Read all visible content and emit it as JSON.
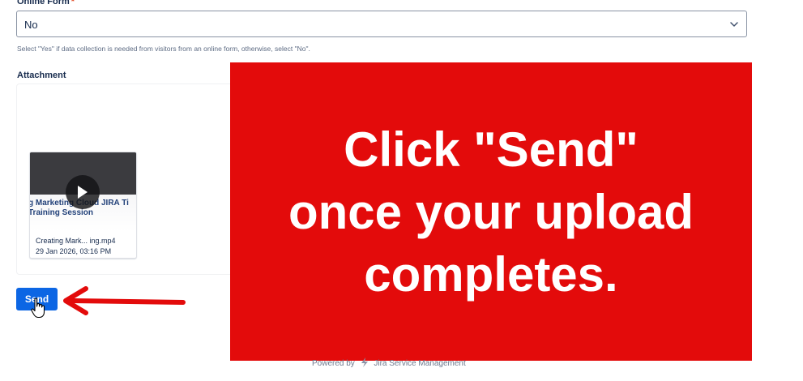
{
  "form": {
    "online_form": {
      "label": "Online Form",
      "required_marker": "*",
      "value": "No",
      "helper_text": "Select \"Yes\" if data collection is needed from visitors from an online form, otherwise, select \"No\"."
    },
    "attachment": {
      "label": "Attachment",
      "file": {
        "thumbnail_line1": "g Marketing Cloud JIRA Ti",
        "thumbnail_line2": "Training Session",
        "name": "Creating Mark... ing.mp4",
        "date": "29 Jan 2026, 03:16 PM"
      }
    },
    "send_label": "Send"
  },
  "overlay": {
    "text": "Click \"Send\"\nonce your upload\ncompletes.",
    "color": "#e30b0b"
  },
  "footer": {
    "powered_by": "Powered by",
    "product": "Jira Service Management"
  },
  "colors": {
    "primary_button": "#0c66e4",
    "arrow": "#e30b0b"
  }
}
